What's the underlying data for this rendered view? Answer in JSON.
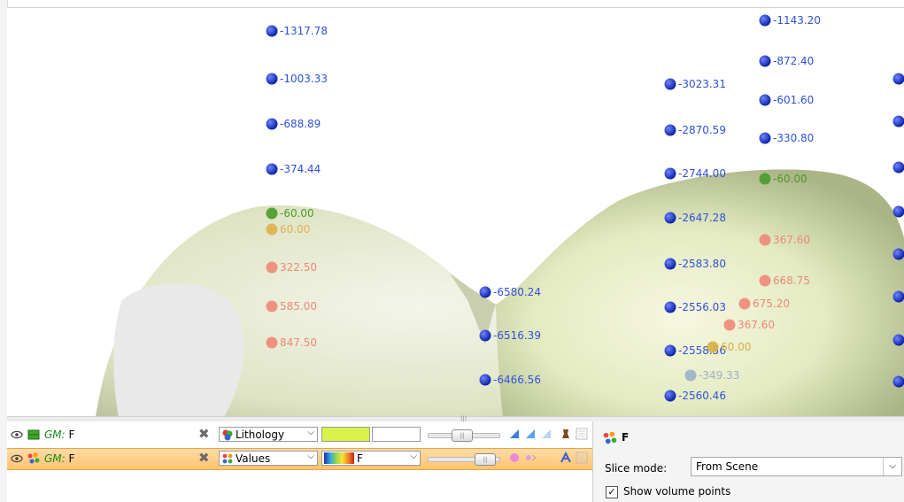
{
  "scene": {
    "well_a": [
      {
        "text": "-1317.78",
        "color": "#2f52d8"
      },
      {
        "text": "-1003.33",
        "color": "#2f52d8"
      },
      {
        "text": "-688.89",
        "color": "#2f52d8"
      },
      {
        "text": "-374.44",
        "color": "#2f52d8"
      },
      {
        "text": "-60.00",
        "color": "#4a9a2a"
      },
      {
        "text": "60.00",
        "color": "#e0b050"
      },
      {
        "text": "322.50",
        "color": "#ee8877"
      },
      {
        "text": "585.00",
        "color": "#ee8877"
      },
      {
        "text": "847.50",
        "color": "#ee8877"
      }
    ],
    "well_b": [
      {
        "text": "-6580.24",
        "color": "#2f52d8"
      },
      {
        "text": "-6516.39",
        "color": "#2f52d8"
      },
      {
        "text": "-6466.56",
        "color": "#2f52d8"
      }
    ],
    "well_c": [
      {
        "text": "-3023.31",
        "color": "#2f52d8"
      },
      {
        "text": "-2870.59",
        "color": "#2f52d8"
      },
      {
        "text": "-2744.00",
        "color": "#2f52d8"
      },
      {
        "text": "-2647.28",
        "color": "#2f52d8"
      },
      {
        "text": "-2583.80",
        "color": "#2f52d8"
      },
      {
        "text": "-2556.03",
        "color": "#2f52d8"
      },
      {
        "text": "-2558.56",
        "color": "#2f52d8"
      },
      {
        "text": "-2560.46",
        "color": "#2f52d8"
      }
    ],
    "well_d": [
      {
        "text": "-1143.20",
        "color": "#2f52d8"
      },
      {
        "text": "-872.40",
        "color": "#2f52d8"
      },
      {
        "text": "-601.60",
        "color": "#2f52d8"
      },
      {
        "text": "-330.80",
        "color": "#2f52d8"
      },
      {
        "text": "-60.00",
        "color": "#4a9a2a"
      },
      {
        "text": "367.60",
        "color": "#ee8877"
      },
      {
        "text": "668.75",
        "color": "#ee8877"
      },
      {
        "text": "675.20",
        "color": "#ee8877"
      },
      {
        "text": "367.60",
        "color": "#ee8877"
      },
      {
        "text": "-349.33",
        "color": "#9ab0c8"
      },
      {
        "text": "60.00",
        "color": "#d8b040"
      }
    ]
  },
  "layers": [
    {
      "prefix": "GM:",
      "name": "F",
      "property": "Lithology",
      "icon": "lithology-icon"
    },
    {
      "prefix": "GM:",
      "name": "F",
      "property": "Values",
      "colormap_label": "F",
      "icon": "values-icon"
    }
  ],
  "colors": {
    "lithology_swatch": "#d8f24a",
    "selection": "#ffc36e",
    "surface": "#e6ead2",
    "point_blue": "#1530c0"
  },
  "properties": {
    "title": "F",
    "slice_mode_label": "Slice mode:",
    "slice_mode_value": "From Scene",
    "show_volume_points_label": "Show volume points",
    "show_volume_points_checked": true
  }
}
